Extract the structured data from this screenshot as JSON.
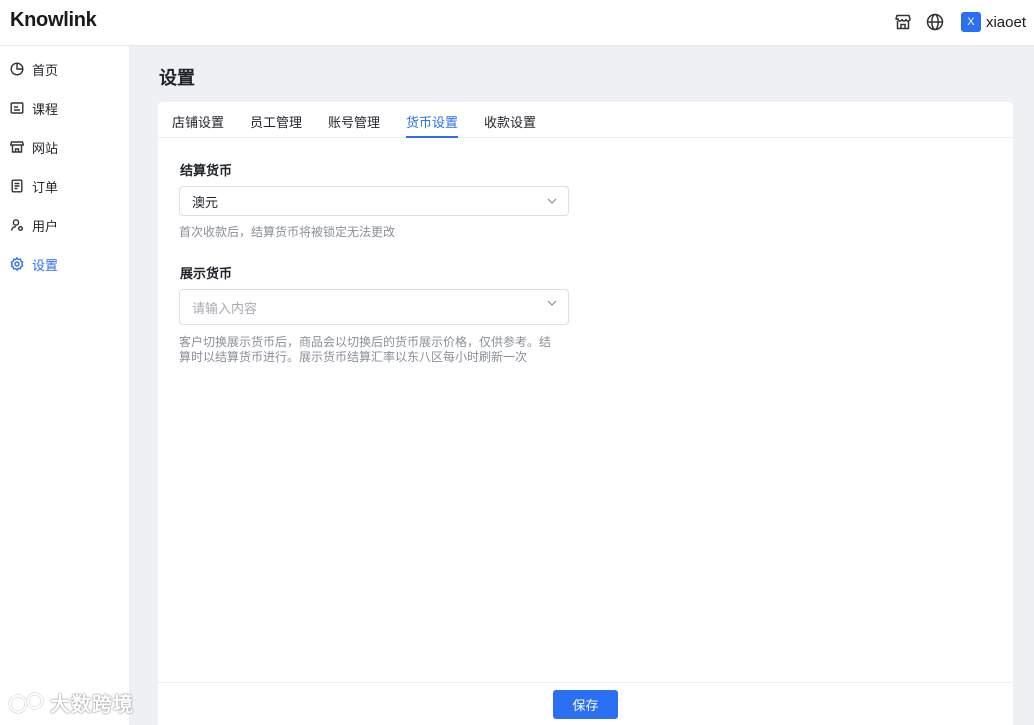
{
  "app": {
    "logo": "Knowlink"
  },
  "header": {
    "icons": [
      "store-icon",
      "globe-icon"
    ],
    "user": {
      "avatar_letter": "X",
      "name": "xiaoet"
    }
  },
  "sidebar": {
    "items": [
      {
        "label": "首页",
        "icon": "pie-chart-icon",
        "active": false
      },
      {
        "label": "课程",
        "icon": "course-icon",
        "active": false
      },
      {
        "label": "网站",
        "icon": "store-icon",
        "active": false
      },
      {
        "label": "订单",
        "icon": "order-icon",
        "active": false
      },
      {
        "label": "用户",
        "icon": "user-icon",
        "active": false
      },
      {
        "label": "设置",
        "icon": "gear-icon",
        "active": true
      }
    ]
  },
  "page": {
    "title": "设置"
  },
  "tabs": [
    {
      "label": "店铺设置",
      "active": false
    },
    {
      "label": "员工管理",
      "active": false
    },
    {
      "label": "账号管理",
      "active": false
    },
    {
      "label": "货币设置",
      "active": true
    },
    {
      "label": "收款设置",
      "active": false
    }
  ],
  "form": {
    "settlement": {
      "label": "结算货币",
      "value": "澳元",
      "hint": "首次收款后，结算货币将被锁定无法更改"
    },
    "display": {
      "label": "展示货币",
      "placeholder": "请输入内容",
      "hint_line1": "客户切换展示货币后，商品会以切换后的货币展示价格，仅供参考。结",
      "hint_line2": "算时以结算货币进行。展示货币结算汇率以东八区每小时刷新一次"
    }
  },
  "footer": {
    "save_label": "保存"
  },
  "watermark": {
    "text": "大数跨境"
  },
  "colors": {
    "accent": "#2b6ff2",
    "background": "#eef0f4"
  }
}
